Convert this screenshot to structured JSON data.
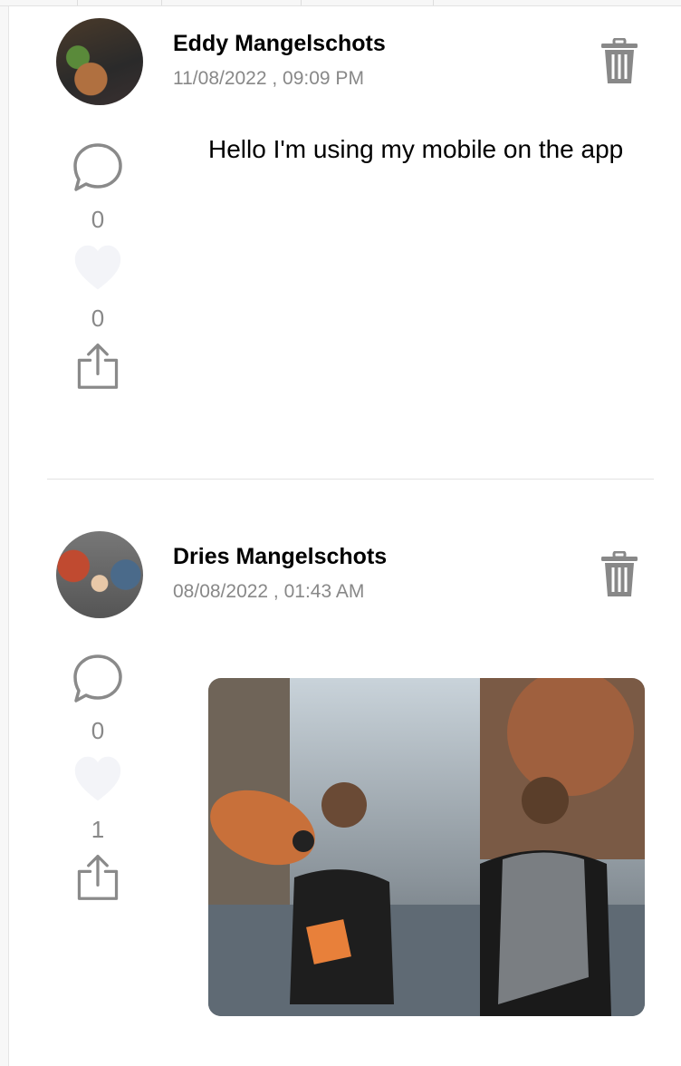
{
  "posts": [
    {
      "author": "Eddy Mangelschots",
      "date": "11/08/2022 , 09:09 PM",
      "text": "Hello I'm using my mobile on the app",
      "comments": "0",
      "likes": "0"
    },
    {
      "author": "Dries Mangelschots",
      "date": "08/08/2022 , 01:43 AM",
      "comments": "0",
      "likes": "1"
    }
  ],
  "icons": {
    "comment": "comment-bubble-icon",
    "like": "heart-icon",
    "share": "share-icon",
    "delete": "trash-icon"
  }
}
